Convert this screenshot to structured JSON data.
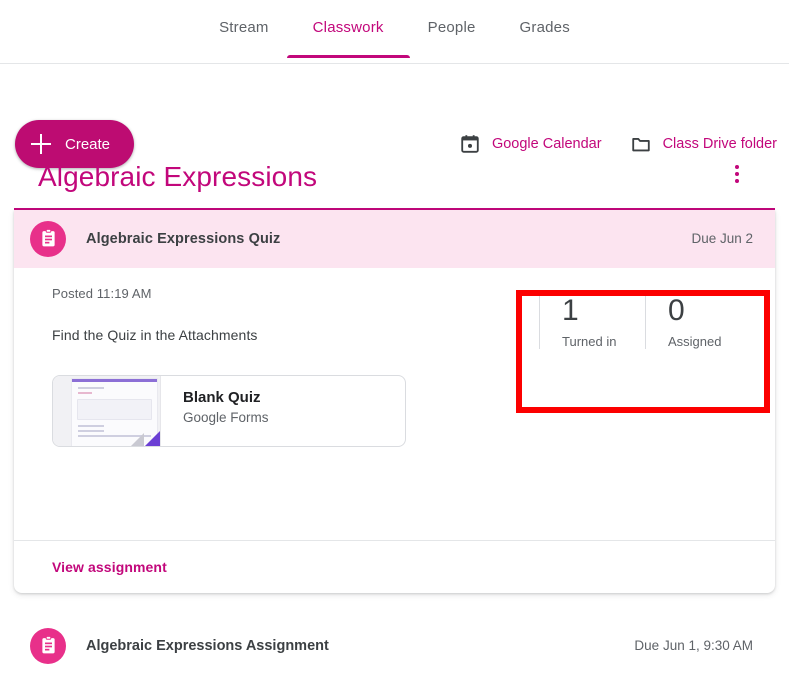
{
  "nav": {
    "tabs": [
      {
        "label": "Stream",
        "active": false
      },
      {
        "label": "Classwork",
        "active": true
      },
      {
        "label": "People",
        "active": false
      },
      {
        "label": "Grades",
        "active": false
      }
    ]
  },
  "toolbar": {
    "create_label": "Create",
    "create_icon": "plus-icon",
    "links": [
      {
        "label": "Google Calendar",
        "icon": "calendar-icon"
      },
      {
        "label": "Class Drive folder",
        "icon": "folder-icon"
      }
    ]
  },
  "topic": {
    "title": "Algebraic Expressions",
    "menu_icon": "more-vert-icon"
  },
  "assignment": {
    "icon": "assignment-clipboard-icon",
    "title": "Algebraic Expressions Quiz",
    "due": "Due Jun 2",
    "posted": "Posted 11:19 AM",
    "description": "Find the Quiz in the Attachments",
    "attachment": {
      "title": "Blank Quiz",
      "subtitle": "Google Forms",
      "thumb_icon": "google-forms-thumbnail"
    },
    "stats": [
      {
        "count": "1",
        "label": "Turned in"
      },
      {
        "count": "0",
        "label": "Assigned"
      }
    ],
    "view_link": "View assignment"
  },
  "next_assignment": {
    "icon": "assignment-clipboard-icon",
    "title": "Algebraic Expressions Assignment",
    "due": "Due Jun 1, 9:30 AM"
  },
  "colors": {
    "accent": "#c2077b",
    "create_button": "#bd0c72",
    "avatar": "#e8308a",
    "row_highlight": "#fce4f0",
    "annotation": "#fc0000",
    "forms_purple": "#6b3fd4"
  }
}
